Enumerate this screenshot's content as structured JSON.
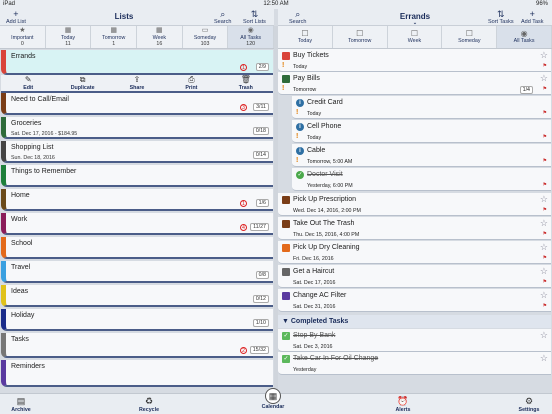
{
  "status": {
    "device": "iPad",
    "time": "12:50 AM",
    "battery": "96%"
  },
  "left_header": {
    "add_label": "Add List",
    "title": "Lists",
    "search_label": "Search",
    "sort_label": "Sort Lists"
  },
  "right_header": {
    "search_label": "Search",
    "title": "Errands",
    "sort_label": "Sort Tasks",
    "add_label": "Add Task"
  },
  "left_tabs": [
    {
      "label": "Important",
      "count": "0",
      "icon": "★"
    },
    {
      "label": "Today",
      "count": "11",
      "icon": "▦"
    },
    {
      "label": "Tomorrow",
      "count": "1",
      "icon": "▦"
    },
    {
      "label": "Week",
      "count": "16",
      "icon": "▦"
    },
    {
      "label": "Someday",
      "count": "103",
      "icon": "▭"
    },
    {
      "label": "All Tasks",
      "count": "120",
      "icon": "◉"
    }
  ],
  "right_tabs": [
    {
      "label": "Today",
      "icon": "☐"
    },
    {
      "label": "Tomorrow",
      "icon": "☐"
    },
    {
      "label": "Week",
      "icon": "☐"
    },
    {
      "label": "Someday",
      "icon": "☐"
    },
    {
      "label": "All Tasks",
      "icon": "◉"
    }
  ],
  "actions": [
    {
      "label": "Edit",
      "icon": "✎"
    },
    {
      "label": "Duplicate",
      "icon": "⧉"
    },
    {
      "label": "Share",
      "icon": "⇪"
    },
    {
      "label": "Print",
      "icon": "⎙"
    },
    {
      "label": "Trash",
      "icon": "🗑"
    }
  ],
  "lists": [
    {
      "name": "Errands",
      "sub": "",
      "alert": "1",
      "count": "2/9",
      "color": "#d9443a"
    },
    {
      "name": "Need to Call/Email",
      "sub": "",
      "alert": "3",
      "count": "3/11",
      "color": "#7a3d17"
    },
    {
      "name": "Groceries",
      "sub": "Sat. Dec 17, 2016 - $184.95",
      "alert": "",
      "count": "0/18",
      "color": "#2e6b3a"
    },
    {
      "name": "Shopping List",
      "sub": "Sun. Dec 18, 2016",
      "alert": "",
      "count": "0/14",
      "color": "#444444"
    },
    {
      "name": "Things to Remember",
      "sub": "",
      "alert": "",
      "count": "",
      "color": "#1e7f3a"
    },
    {
      "name": "Home",
      "sub": "",
      "alert": "1",
      "count": "1/6",
      "color": "#6b4a1a"
    },
    {
      "name": "Work",
      "sub": "",
      "alert": "4",
      "count": "11/27",
      "color": "#8b1d5a"
    },
    {
      "name": "School",
      "sub": "",
      "alert": "",
      "count": "",
      "color": "#e36a1b"
    },
    {
      "name": "Travel",
      "sub": "",
      "alert": "",
      "count": "0/8",
      "color": "#3aa0e0"
    },
    {
      "name": "Ideas",
      "sub": "",
      "alert": "",
      "count": "0/12",
      "color": "#e0c21b"
    },
    {
      "name": "Holiday",
      "sub": "",
      "alert": "",
      "count": "1/10",
      "color": "#1a2c8a"
    },
    {
      "name": "Tasks",
      "sub": "",
      "alert": "2",
      "count": "15/32",
      "color": "#777777"
    },
    {
      "name": "Reminders",
      "sub": "",
      "alert": "",
      "count": "",
      "color": "#5a3aa0"
    }
  ],
  "tasks": [
    {
      "name": "Buy Tickets",
      "due": "Today",
      "type": "sq",
      "color": "#d9443a",
      "prio": "!",
      "star": "☆"
    },
    {
      "name": "Pay Bills",
      "due": "Tomorrow",
      "type": "sq",
      "color": "#2e6b3a",
      "prio": "!",
      "star": "☆",
      "badge": "1/4"
    },
    {
      "name": "Credit Card",
      "due": "Today",
      "type": "sub",
      "prio": "!"
    },
    {
      "name": "Cell Phone",
      "due": "Today",
      "type": "sub",
      "prio": "!"
    },
    {
      "name": "Cable",
      "due": "Tomorrow, 5:00 AM",
      "type": "sub",
      "prio": "!"
    },
    {
      "name": "Doctor Visit",
      "due": "Yesterday, 6:00 PM",
      "type": "subdone",
      "prio": ""
    },
    {
      "name": "Pick Up Prescription",
      "due": "Wed. Dec 14, 2016, 2:00 PM",
      "type": "sq",
      "color": "#7a3d17",
      "star": "☆"
    },
    {
      "name": "Take Out The Trash",
      "due": "Thu. Dec 15, 2016, 4:00 PM",
      "type": "sq",
      "color": "#7a3d17",
      "star": "☆"
    },
    {
      "name": "Pick Up Dry Cleaning",
      "due": "Fri. Dec 16, 2016",
      "type": "sq",
      "color": "#e36a1b",
      "star": "☆"
    },
    {
      "name": "Get a Haircut",
      "due": "Sat. Dec 17, 2016",
      "type": "sq",
      "color": "#666666",
      "star": "☆"
    },
    {
      "name": "Change AC Filter",
      "due": "Sat. Dec 31, 2016",
      "type": "sq",
      "color": "#5a3aa0",
      "star": "☆"
    }
  ],
  "completed_header": "Completed Tasks",
  "completed": [
    {
      "name": "Stop By Bank",
      "due": "Sat. Dec 3, 2016"
    },
    {
      "name": "Take Car In For Oil Change",
      "due": "Yesterday"
    }
  ],
  "bottom": [
    {
      "label": "Archive",
      "icon": "▤"
    },
    {
      "label": "Recycle",
      "icon": "♻"
    },
    {
      "label": "Calendar",
      "icon": "▦"
    },
    {
      "label": "Alerts",
      "icon": "⏰"
    },
    {
      "label": "Settings",
      "icon": "⚙"
    }
  ]
}
